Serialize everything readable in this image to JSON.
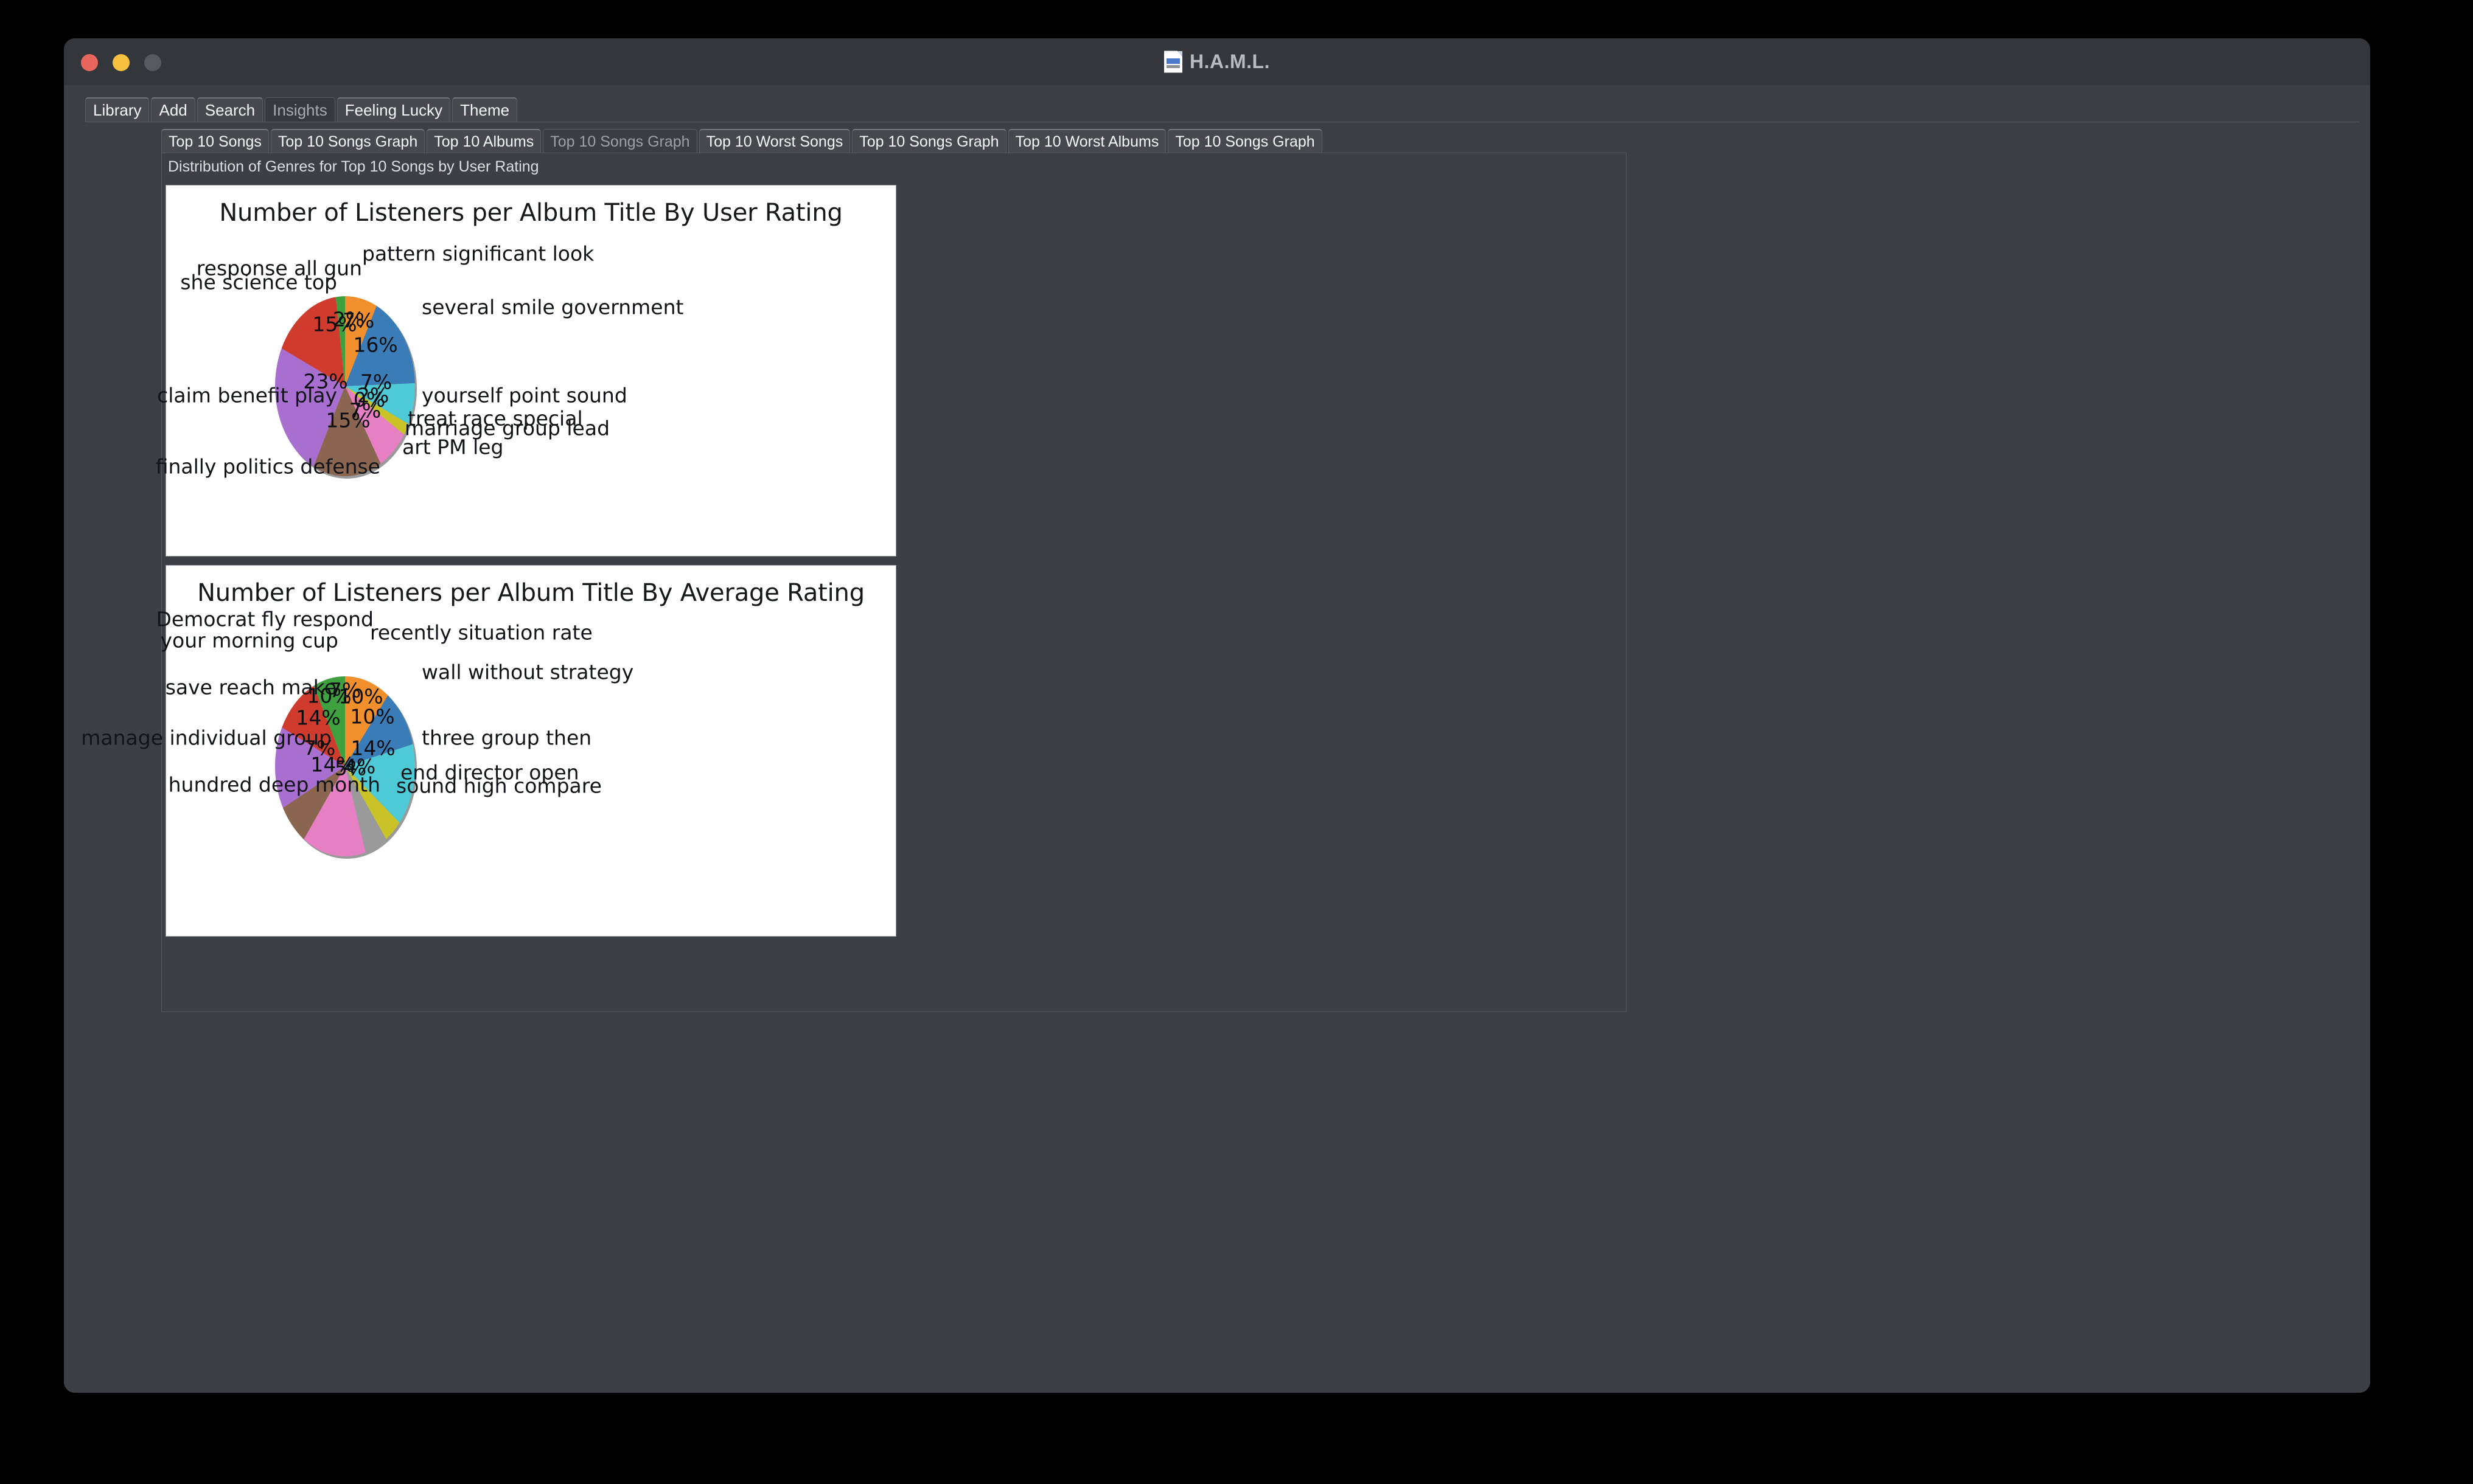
{
  "window": {
    "title": "H.A.M.L.",
    "title_icon": "document-icon",
    "controls": [
      {
        "name": "close",
        "color": "#e8665c"
      },
      {
        "name": "minimize",
        "color": "#f5c13f"
      },
      {
        "name": "maximize",
        "color": "#565a5e"
      }
    ]
  },
  "outer_tabs": [
    {
      "label": "Library",
      "active": false
    },
    {
      "label": "Add",
      "active": false
    },
    {
      "label": "Search",
      "active": false
    },
    {
      "label": "Insights",
      "active": true
    },
    {
      "label": "Feeling Lucky",
      "active": false
    },
    {
      "label": "Theme",
      "active": false
    }
  ],
  "inner_tabs": [
    {
      "label": "Top 10 Songs",
      "active": false
    },
    {
      "label": "Top 10 Songs Graph",
      "active": false
    },
    {
      "label": "Top 10 Albums",
      "active": false
    },
    {
      "label": "Top 10 Songs Graph",
      "active": true
    },
    {
      "label": "Top 10 Worst Songs",
      "active": false
    },
    {
      "label": "Top 10 Songs Graph",
      "active": false
    },
    {
      "label": "Top 10 Worst Albums",
      "active": false
    },
    {
      "label": "Top 10 Songs Graph",
      "active": false
    }
  ],
  "panel": {
    "caption": "Distribution of Genres for Top 10 Songs by User Rating"
  },
  "chart_data": [
    {
      "type": "pie",
      "title": "Number of Listeners per Album Title By User Rating",
      "start_angle_deg": 90,
      "direction": "clockwise",
      "labels": [
        "pattern significant look",
        "several smile government",
        "yourself point sound",
        "treat race special",
        "marriage group lead",
        "art PM leg",
        "finally politics defense",
        "claim benefit play",
        "she science top",
        "response all gun"
      ],
      "percent_labels": [
        "7%",
        "16%",
        "7%",
        "2%",
        "0%",
        "7%",
        "15%",
        "23%",
        "15%",
        "2%"
      ],
      "values": [
        7,
        16,
        7,
        2,
        0,
        7,
        15,
        23,
        15,
        2
      ],
      "colors": [
        "#f18f2c",
        "#3a7cb8",
        "#4ec9d6",
        "#c9c327",
        "#9a9a9a",
        "#e77fc4",
        "#8a6550",
        "#a濃",
        "#cf3c2e",
        "#3fa03f"
      ],
      "slice_colors": [
        "#f18f2c",
        "#3a7cb8",
        "#4ec9d6",
        "#c9c327",
        "#9a9a9a",
        "#e77fc4",
        "#8a6550",
        "#a86fd0",
        "#cf3c2e",
        "#3fa03f"
      ]
    },
    {
      "type": "pie",
      "title": "Number of Listeners per Album Title By Average Rating",
      "start_angle_deg": 90,
      "direction": "clockwise",
      "labels": [
        "recently situation rate",
        "wall without strategy",
        "three group then",
        "end director open",
        "sound high compare",
        "hundred deep month",
        "manage individual group",
        "save reach make",
        "your morning cup",
        "Democrat fly respond"
      ],
      "percent_labels": [
        "10%",
        "10%",
        "14%",
        "4%",
        "5%",
        "14%",
        "7%",
        "14%",
        "10%",
        "7%"
      ],
      "values": [
        10,
        10,
        14,
        4,
        5,
        14,
        7,
        14,
        10,
        7
      ],
      "slice_colors": [
        "#f18f2c",
        "#3a7cb8",
        "#4ec9d6",
        "#c9c327",
        "#9a9a9a",
        "#e77fc4",
        "#8a6550",
        "#a86fd0",
        "#cf3c2e",
        "#3fa03f"
      ]
    }
  ]
}
